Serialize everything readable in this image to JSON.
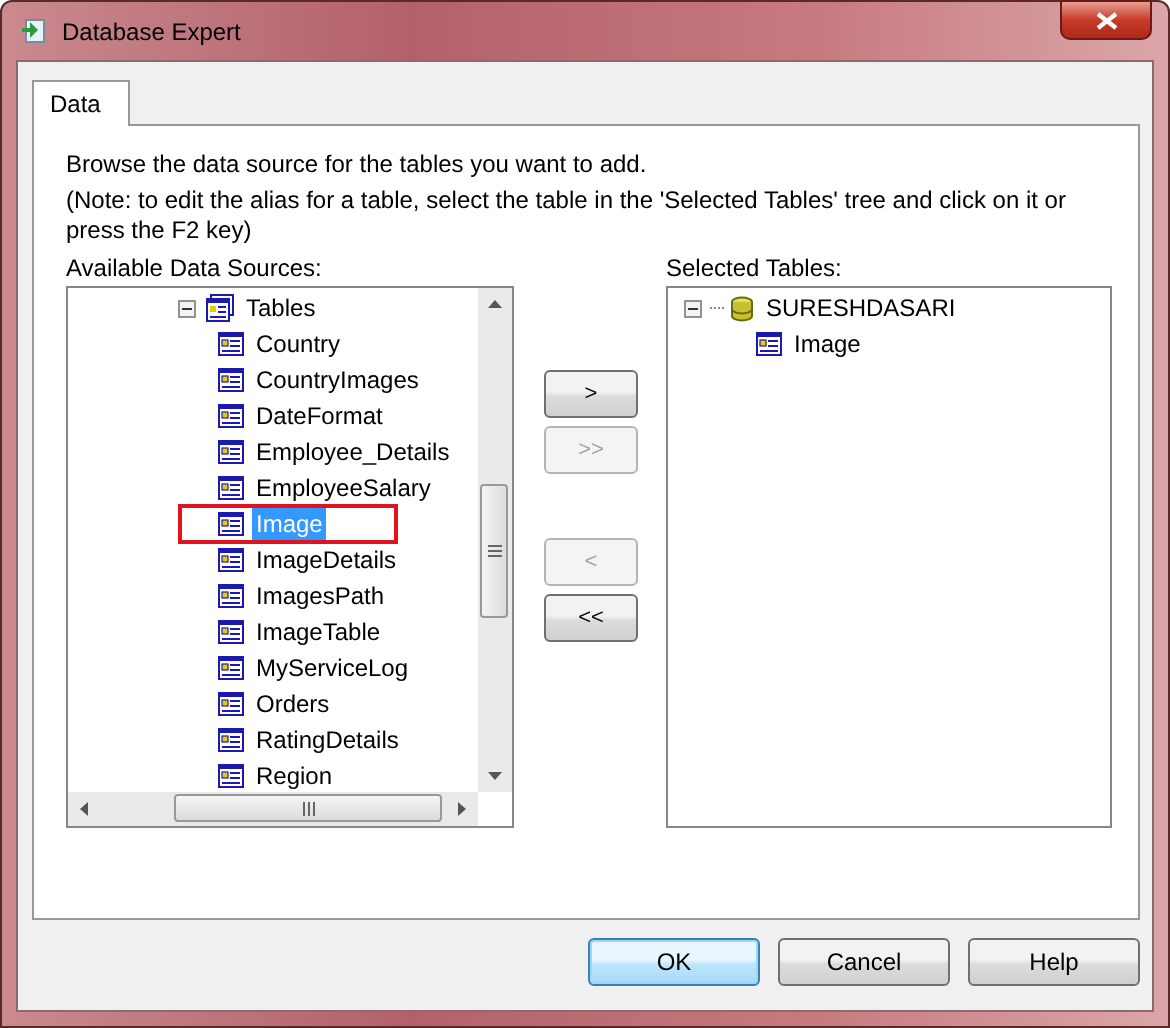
{
  "window": {
    "title": "Database Expert"
  },
  "tabs": [
    {
      "label": "Data",
      "selected": true
    }
  ],
  "instructions": [
    "Browse the data source for the tables you want to add.",
    "(Note: to edit the alias for a table, select the table in the 'Selected Tables' tree and click on it or press the F2 key)"
  ],
  "available": {
    "label": "Available Data Sources:",
    "tree": [
      {
        "label": "Tables",
        "kind": "folder",
        "expanded": true,
        "selected": false,
        "highlighted": false,
        "children": [
          {
            "label": "Country",
            "kind": "table",
            "selected": false,
            "highlighted": false
          },
          {
            "label": "CountryImages",
            "kind": "table",
            "selected": false,
            "highlighted": false
          },
          {
            "label": "DateFormat",
            "kind": "table",
            "selected": false,
            "highlighted": false
          },
          {
            "label": "Employee_Details",
            "kind": "table",
            "selected": false,
            "highlighted": false
          },
          {
            "label": "EmployeeSalary",
            "kind": "table",
            "selected": false,
            "highlighted": false
          },
          {
            "label": "Image",
            "kind": "table",
            "selected": true,
            "highlighted": true
          },
          {
            "label": "ImageDetails",
            "kind": "table",
            "selected": false,
            "highlighted": false
          },
          {
            "label": "ImagesPath",
            "kind": "table",
            "selected": false,
            "highlighted": false
          },
          {
            "label": "ImageTable",
            "kind": "table",
            "selected": false,
            "highlighted": false
          },
          {
            "label": "MyServiceLog",
            "kind": "table",
            "selected": false,
            "highlighted": false
          },
          {
            "label": "Orders",
            "kind": "table",
            "selected": false,
            "highlighted": false
          },
          {
            "label": "RatingDetails",
            "kind": "table",
            "selected": false,
            "highlighted": false
          },
          {
            "label": "Region",
            "kind": "table",
            "selected": false,
            "highlighted": false
          }
        ]
      }
    ]
  },
  "move_buttons": [
    {
      "label": ">",
      "disabled": false
    },
    {
      "label": ">>",
      "disabled": true
    },
    {
      "label": "<",
      "disabled": true
    },
    {
      "label": "<<",
      "disabled": false
    }
  ],
  "selected_tables": {
    "label": "Selected Tables:",
    "tree": [
      {
        "label": "SURESHDASARI",
        "kind": "database",
        "expanded": true,
        "selected": false,
        "highlighted": false,
        "children": [
          {
            "label": "Image",
            "kind": "table",
            "selected": false,
            "highlighted": false
          }
        ]
      }
    ]
  },
  "buttons": [
    {
      "label": "OK",
      "default": true
    },
    {
      "label": "Cancel",
      "default": false
    },
    {
      "label": "Help",
      "default": false
    }
  ]
}
